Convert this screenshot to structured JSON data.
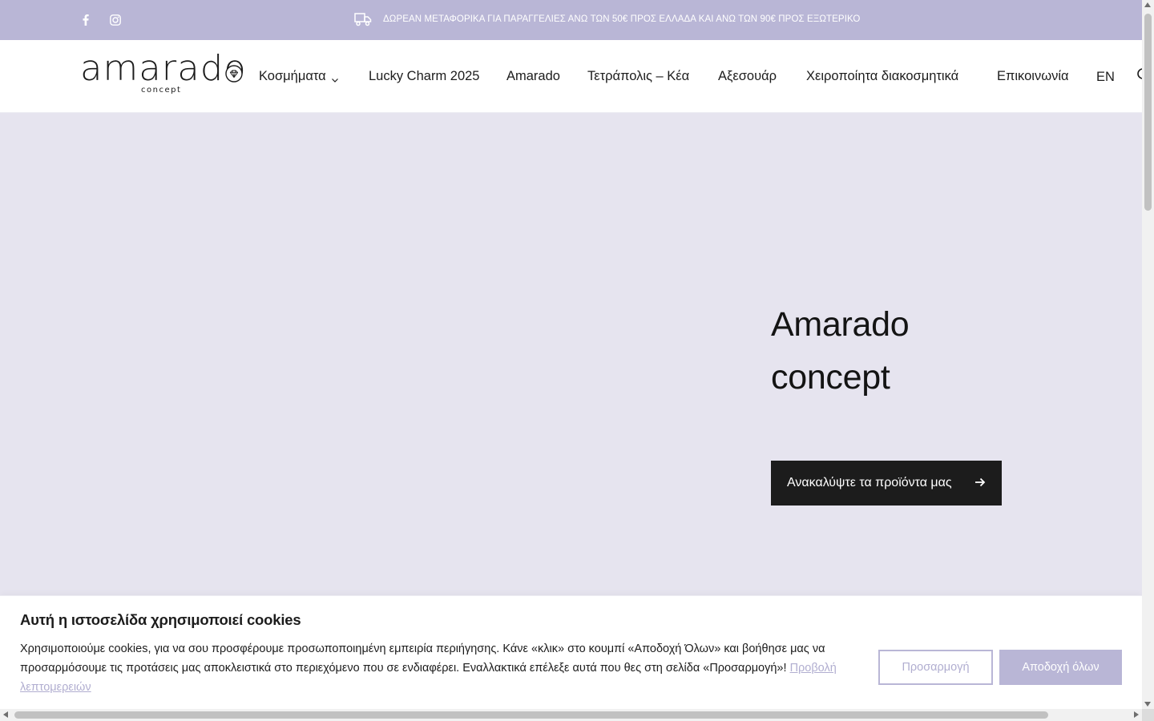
{
  "topbar": {
    "background": "#b9b6d6",
    "social": [
      {
        "icon": "facebook-icon"
      },
      {
        "icon": "instagram-icon"
      }
    ],
    "announcement_icon": "truck-icon",
    "announcement": "ΔΩΡΕΑΝ ΜΕΤΑΦΟΡΙΚΑ ΓΙΑ ΠΑΡΑΓΓΕΛΙΕΣ ΑΝΩ ΤΩΝ 50€ ΠΡΟΣ ΕΛΛΑΔΑ ΚΑΙ ΑΝΩ ΤΩΝ 90€ ΠΡΟΣ ΕΞΩΤΕΡΙΚΟ"
  },
  "header": {
    "logo": {
      "word": "amarado",
      "sub": "concept",
      "mark_icon": "diamond-icon"
    },
    "nav": [
      {
        "label": "Κοσμήματα",
        "has_dropdown": true
      },
      {
        "label": "Lucky Charm 2025"
      },
      {
        "label": "Amarado"
      },
      {
        "label": "Τετράπολις – Κέα"
      },
      {
        "label": "Αξεσουάρ"
      },
      {
        "label": "Χειροποίητα διακοσμητικά"
      },
      {
        "label": "Επικοινωνία"
      }
    ],
    "language": "EN",
    "search_icon": "search-icon"
  },
  "hero": {
    "background": "#e6e4ef",
    "title_line1": "Amarado",
    "title_line2": "concept",
    "cta_label": "Ανακαλύψτε τα προϊόντα μας",
    "cta_icon": "arrow-right-icon"
  },
  "cookie": {
    "title": "Αυτή η ιστοσελίδα χρησιμοποιεί cookies",
    "text": "Χρησιμοποιούμε cookies, για να σου προσφέρουμε προσωποποιημένη εμπειρία περιήγησης. Κάνε «κλικ» στο κουμπί «Αποδοχή Όλων» και βοήθησε μας να προσαρμόσουμε τις προτάσεις μας αποκλειστικά στο περιεχόμενο που σε ενδιαφέρει. Εναλλακτικά επέλεξε αυτά που θες στη σελίδα «Προσαρμογή»!",
    "details_link": "Προβολή λεπτομερειών",
    "customize_label": "Προσαρμογή",
    "accept_label": "Αποδοχή όλων",
    "accent": "#b9b6d6"
  }
}
